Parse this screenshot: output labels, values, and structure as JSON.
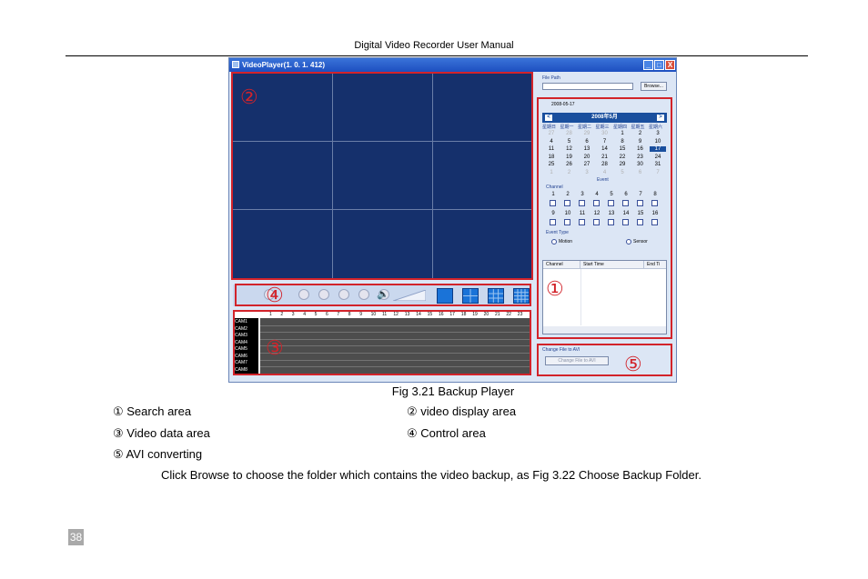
{
  "doc_header": "Digital Video Recorder User Manual",
  "player": {
    "title": "VideoPlayer(1. 0. 1. 412)",
    "window_buttons": {
      "minimize": "_",
      "maximize": "□",
      "close": "X"
    },
    "file_path_label": "File Path",
    "file_path_value": "",
    "browse_label": "Browse...",
    "date_value": "2008-05-17",
    "calendar": {
      "header": "2008年5月",
      "prev": "<",
      "next": ">",
      "weekdays": [
        "星期日",
        "星期一",
        "星期二",
        "星期三",
        "星期四",
        "星期五",
        "星期六"
      ],
      "weeks": [
        [
          "27",
          "28",
          "29",
          "30",
          "1",
          "2",
          "3"
        ],
        [
          "4",
          "5",
          "6",
          "7",
          "8",
          "9",
          "10"
        ],
        [
          "11",
          "12",
          "13",
          "14",
          "15",
          "16",
          "17"
        ],
        [
          "18",
          "19",
          "20",
          "21",
          "22",
          "23",
          "24"
        ],
        [
          "25",
          "26",
          "27",
          "28",
          "29",
          "30",
          "31"
        ],
        [
          "1",
          "2",
          "3",
          "4",
          "5",
          "6",
          "7"
        ]
      ],
      "selected": "17"
    },
    "event_label": "Event",
    "channel_label": "Channel",
    "channels_row1": [
      "1",
      "2",
      "3",
      "4",
      "5",
      "6",
      "7",
      "8"
    ],
    "channels_row2": [
      "9",
      "10",
      "11",
      "12",
      "13",
      "14",
      "15",
      "16"
    ],
    "event_type_label": "Event Type",
    "event_types": [
      "Motion",
      "Sensor"
    ],
    "list_columns": [
      "Channel",
      "Start Time",
      "End Ti"
    ],
    "avi_label": "Change File to AVI",
    "avi_button": "Change File to AVI",
    "timeline_hours": [
      "1",
      "2",
      "3",
      "4",
      "5",
      "6",
      "7",
      "8",
      "9",
      "10",
      "11",
      "12",
      "13",
      "14",
      "15",
      "16",
      "17",
      "18",
      "19",
      "20",
      "21",
      "22",
      "23"
    ],
    "timeline_channels": [
      "CAM1",
      "CAM2",
      "CAM3",
      "CAM4",
      "CAM5",
      "CAM6",
      "CAM7",
      "CAM8"
    ],
    "callouts": {
      "search": "①",
      "video": "②",
      "timeline": "③",
      "control": "④",
      "avi": "⑤"
    }
  },
  "caption": "Fig 3.21 Backup Player",
  "legend": [
    {
      "label": "① Search area"
    },
    {
      "label": "② video display area"
    },
    {
      "label": "③ Video data area"
    },
    {
      "label": "④ Control area"
    },
    {
      "label": "⑤ AVI converting"
    }
  ],
  "instruction": "Click Browse to choose the folder which contains the video backup, as Fig 3.22 Choose Backup Folder.",
  "page_number": "38"
}
